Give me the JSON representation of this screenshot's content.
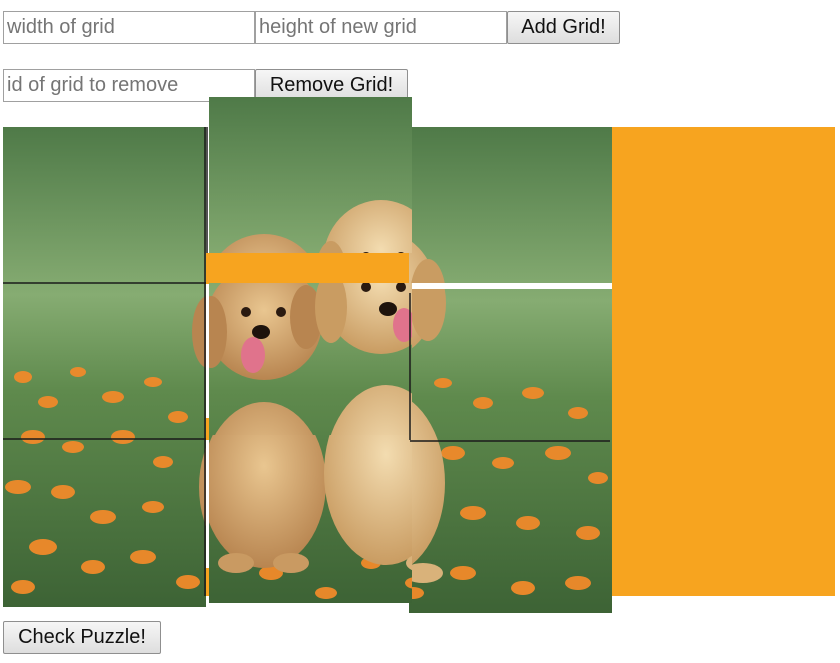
{
  "add_grid": {
    "width_placeholder": "width of grid",
    "height_placeholder": "height of new grid",
    "button_label": "Add Grid!"
  },
  "remove_grid": {
    "id_placeholder": "id of grid to remove",
    "button_label": "Remove Grid!"
  },
  "check_button_label": "Check Puzzle!",
  "colors": {
    "tray": "#f7a41f",
    "grass_light": "#7aa566",
    "grass_dark": "#3f6b3b",
    "flower": "#f08a2a",
    "puppy_fur": "#d9b27a",
    "tongue": "#e0738c",
    "tile_border": "#1a1a1a"
  },
  "puzzle": {
    "image_subject": "two golden retriever puppies sitting in grass with orange flowers",
    "tiles": [
      {
        "id": "tile-r1c1"
      },
      {
        "id": "tile-r1c2"
      },
      {
        "id": "tile-r1c3"
      },
      {
        "id": "tile-r2c1"
      },
      {
        "id": "tile-r2c2"
      },
      {
        "id": "tile-r2c3"
      },
      {
        "id": "tile-r3c1"
      },
      {
        "id": "tile-r3c2"
      },
      {
        "id": "tile-r3c3"
      }
    ]
  }
}
